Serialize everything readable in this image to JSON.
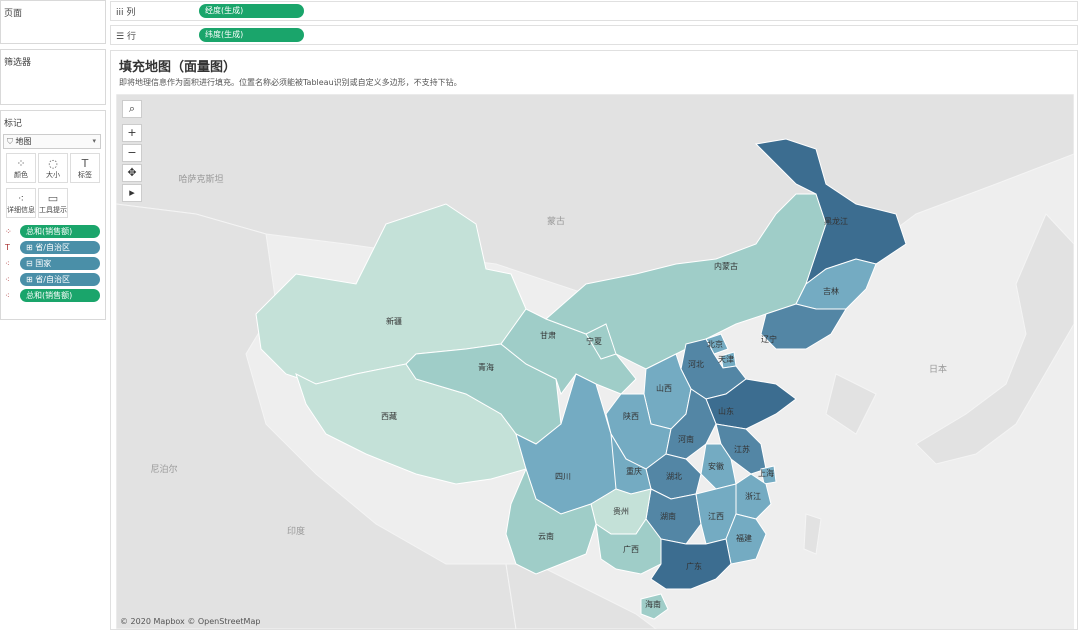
{
  "panels": {
    "pages": "页面",
    "filters": "筛选器",
    "marks": "标记"
  },
  "marks": {
    "type": "地图",
    "buttons": [
      {
        "icon": "color-icon",
        "glyph": "⁘",
        "label": "颜色"
      },
      {
        "icon": "size-icon",
        "glyph": "◌",
        "label": "大小"
      },
      {
        "icon": "label-icon",
        "glyph": "T",
        "label": "标签"
      },
      {
        "icon": "detail-icon",
        "glyph": "⁖",
        "label": "详细信息"
      },
      {
        "icon": "tooltip-icon",
        "glyph": "▭",
        "label": "工具提示"
      }
    ],
    "pills": [
      {
        "icon": "⁘",
        "label": "总和(销售额)",
        "color": "green"
      },
      {
        "icon": "T",
        "label": "⊞ 省/自治区",
        "color": "blue"
      },
      {
        "icon": "⁖",
        "label": "⊟ 国家",
        "color": "blue"
      },
      {
        "icon": "⁖",
        "label": "⊞ 省/自治区",
        "color": "blue"
      },
      {
        "icon": "⁖",
        "label": "总和(销售额)",
        "color": "green"
      }
    ]
  },
  "shelves": {
    "columns_icon": "iii",
    "columns_label": "列",
    "columns_pill": "经度(生成)",
    "rows_icon": "☰",
    "rows_label": "行",
    "rows_pill": "纬度(生成)"
  },
  "view": {
    "title": "填充地图（面量图）",
    "subtitle": "即将地理信息作为面积进行填充。位置名称必须能被Tableau识别或自定义多边形，不支持下钻。",
    "attribution": "© 2020 Mapbox © OpenStreetMap"
  },
  "map_tools": [
    {
      "name": "search-tool",
      "glyph": "⌕"
    },
    {
      "name": "zoom-in-button",
      "glyph": "+"
    },
    {
      "name": "zoom-out-button",
      "glyph": "−"
    },
    {
      "name": "pan-tool",
      "glyph": "✥"
    },
    {
      "name": "expand-toolbar-button",
      "glyph": "▸"
    }
  ],
  "map": {
    "colors": {
      "background": "#eeeeee",
      "land": "#e2e2e2",
      "border": "#ffffff",
      "scale": [
        "#c4e1d8",
        "#9fcdc8",
        "#74abc2",
        "#5386a5",
        "#3c6d90"
      ]
    },
    "basemap_labels": [
      "蒙古",
      "哈萨克斯坦",
      "日本",
      "印度",
      "尼泊尔"
    ],
    "regions": [
      {
        "name": "新疆",
        "level": 0
      },
      {
        "name": "西藏",
        "level": 0
      },
      {
        "name": "青海",
        "level": 1
      },
      {
        "name": "甘肃",
        "level": 1
      },
      {
        "name": "内蒙古",
        "level": 1
      },
      {
        "name": "宁夏",
        "level": 1
      },
      {
        "name": "黑龙江",
        "level": 4
      },
      {
        "name": "吉林",
        "level": 2
      },
      {
        "name": "辽宁",
        "level": 3
      },
      {
        "name": "北京",
        "level": 2
      },
      {
        "name": "天津",
        "level": 2
      },
      {
        "name": "河北",
        "level": 3
      },
      {
        "name": "山西",
        "level": 2
      },
      {
        "name": "陕西",
        "level": 2
      },
      {
        "name": "山东",
        "level": 4
      },
      {
        "name": "河南",
        "level": 3
      },
      {
        "name": "江苏",
        "level": 3
      },
      {
        "name": "安徽",
        "level": 2
      },
      {
        "name": "上海",
        "level": 2
      },
      {
        "name": "浙江",
        "level": 2
      },
      {
        "name": "湖北",
        "level": 3
      },
      {
        "name": "四川",
        "level": 2
      },
      {
        "name": "重庆",
        "level": 2
      },
      {
        "name": "湖南",
        "level": 3
      },
      {
        "name": "江西",
        "level": 2
      },
      {
        "name": "福建",
        "level": 2
      },
      {
        "name": "贵州",
        "level": 0
      },
      {
        "name": "云南",
        "level": 1
      },
      {
        "name": "广西",
        "level": 1
      },
      {
        "name": "广东",
        "level": 4
      },
      {
        "name": "海南",
        "level": 1
      }
    ]
  }
}
